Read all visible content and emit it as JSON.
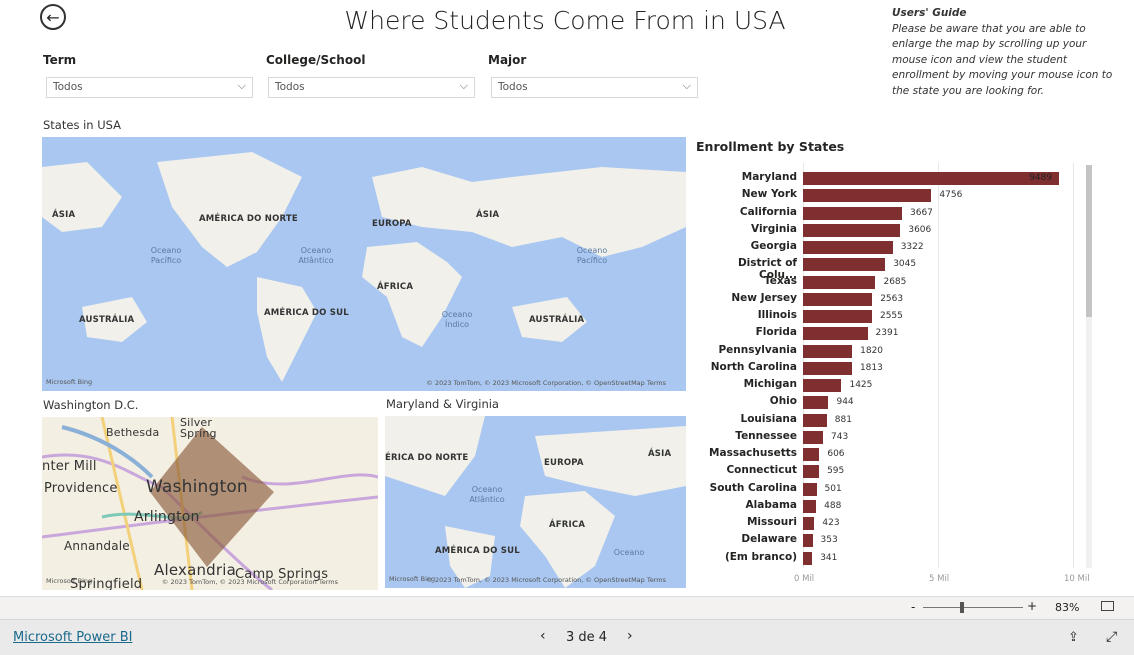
{
  "header": {
    "title": "Where Students Come From in USA",
    "back_icon": "arrow-left-circle-icon"
  },
  "guide": {
    "title": "Users' Guide",
    "text": "Please be aware that you are able to enlarge the map by scrolling up your mouse icon and view the student enrollment by moving your mouse icon to the state you are looking for."
  },
  "filters": [
    {
      "label": "Term",
      "value": "Todos"
    },
    {
      "label": "College/School",
      "value": "Todos"
    },
    {
      "label": "Major",
      "value": "Todos"
    }
  ],
  "maps": {
    "usa": {
      "title": "States in USA",
      "labels": [
        "ÁSIA",
        "AMÉRICA DO NORTE",
        "EUROPA",
        "ÁSIA",
        "ÁFRICA",
        "AMÉRICA DO SUL",
        "AUSTRÁLIA",
        "AUSTRÁLIA"
      ],
      "oceans": [
        "Oceano Pacífico",
        "Oceano Atlântico",
        "Oceano Índico",
        "Oceano Pacífico"
      ],
      "attribution": "© 2023 TomTom, © 2023 Microsoft Corporation, © OpenStreetMap  Terms",
      "logo": "Microsoft Bing"
    },
    "dc": {
      "title": "Washington D.C.",
      "labels": [
        "Bethesda",
        "Silver Spring",
        "nter Mill",
        "Providence",
        "Washington",
        "Arlington",
        "Annandale",
        "Alexandria",
        "Camp Springs",
        "Springfield"
      ],
      "attribution": "© 2023 TomTom, © 2023 Microsoft Corporation  Terms",
      "logo": "Microsoft Bing",
      "highlight_color": "#8b5a3c"
    },
    "mdva": {
      "title": "Maryland & Virginia",
      "labels": [
        "ÉRICA DO NORTE",
        "EUROPA",
        "ÁSIA",
        "ÁFRICA",
        "AMÉRICA DO SUL"
      ],
      "oceans": [
        "Oceano Atlântico",
        "Oceano"
      ],
      "attribution": "© 2023 TomTom, © 2023 Microsoft Corporation, © OpenStreetMap  Terms",
      "logo": "Microsoft Bing"
    }
  },
  "chart_data": {
    "type": "bar",
    "orientation": "horizontal",
    "title": "Enrollment by States",
    "categories": [
      "Maryland",
      "New York",
      "California",
      "Virginia",
      "Georgia",
      "District of Colu...",
      "Texas",
      "New Jersey",
      "Illinois",
      "Florida",
      "Pennsylvania",
      "North Carolina",
      "Michigan",
      "Ohio",
      "Louisiana",
      "Tennessee",
      "Massachusetts",
      "Connecticut",
      "South Carolina",
      "Alabama",
      "Missouri",
      "Delaware",
      "(Em branco)"
    ],
    "values": [
      9489,
      4756,
      3667,
      3606,
      3322,
      3045,
      2685,
      2563,
      2555,
      2391,
      1820,
      1813,
      1425,
      944,
      881,
      743,
      606,
      595,
      501,
      488,
      423,
      353,
      341
    ],
    "xlim": [
      0,
      10000
    ],
    "ticks": [
      "0 Mil",
      "5 Mil",
      "10 Mil"
    ],
    "bar_color": "#7f2f30",
    "grid": true
  },
  "zoom": {
    "minus": "-",
    "plus": "+",
    "level": "83%",
    "level_value": 83,
    "fit_icon": "fit-page-icon"
  },
  "footer": {
    "brand": "Microsoft Power BI",
    "page": "3 de 4",
    "prev_icon": "chevron-left-icon",
    "next_icon": "chevron-right-icon",
    "share_icon": "share-icon",
    "fullscreen_icon": "expand-icon"
  }
}
